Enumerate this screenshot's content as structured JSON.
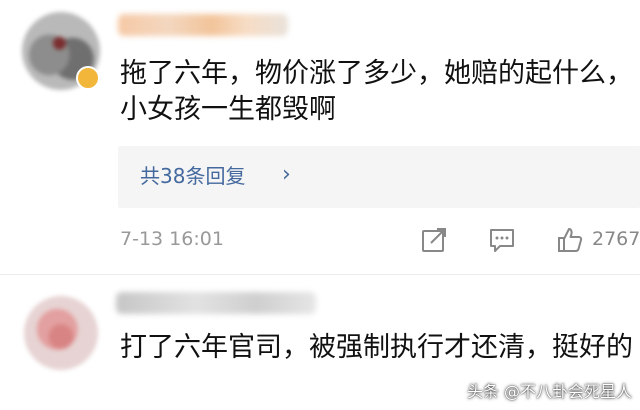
{
  "comments": [
    {
      "text": "拖了六年，物价涨了多少，她赔的起什么，小女孩一生都毁啊",
      "replies_link": "共38条回复",
      "replies_arrow": "›",
      "timestamp": "7-13 16:01",
      "like_count": "2767"
    },
    {
      "text": "打了六年官司，被强制执行才还清，挺好的"
    }
  ],
  "watermark": "头条 @不八卦会死星人",
  "colors": {
    "link": "#44699e",
    "meta_text": "#999999",
    "reply_box_bg": "#f5f5f5"
  },
  "icons": {
    "share": "share-icon",
    "comment": "comment-icon",
    "like": "thumbs-up-icon"
  }
}
